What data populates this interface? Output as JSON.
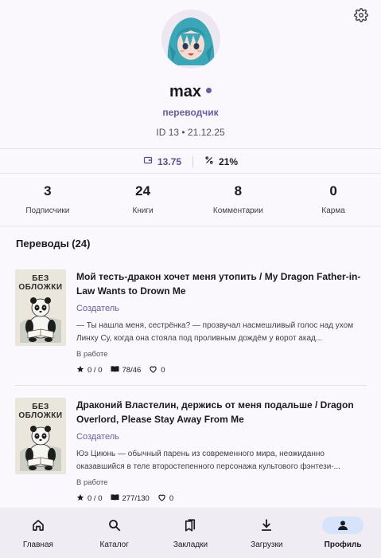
{
  "profile": {
    "name": "max",
    "role": "переводчик",
    "id_line": "ID 13 • 21.12.25",
    "balance": "13.75",
    "percent": "21%"
  },
  "counters": [
    {
      "value": "3",
      "label": "Подписчики"
    },
    {
      "value": "24",
      "label": "Книги"
    },
    {
      "value": "8",
      "label": "Комментарии"
    },
    {
      "value": "0",
      "label": "Карма"
    }
  ],
  "section": {
    "title": "Переводы (24)"
  },
  "books": [
    {
      "cover_text_1": "БЕЗ",
      "cover_text_2": "ОБЛОЖКИ",
      "title": "Мой тесть-дракон хочет меня утопить / My Dragon Father-in-Law Wants to Drown Me",
      "creator": "Создатель",
      "description": "— Ты нашла меня, сестрёнка? — прозвучал насмешливый голос над ухом Линху Су, когда она стояла под проливным дождём у ворот акад...",
      "status": "В работе",
      "rating": "0 / 0",
      "chapters": "78/46",
      "likes": "0"
    },
    {
      "cover_text_1": "БЕЗ",
      "cover_text_2": "ОБЛОЖКИ",
      "title": "Драконий Властелин, держись от меня подальше / Dragon Overlord, Please Stay Away From Me",
      "creator": "Создатель",
      "description": "Юэ Циюнь — обычный парень из современного мира, неожиданно оказавшийся в теле второстепенного персонажа культового фэнтези-...",
      "status": "В работе",
      "rating": "0 / 0",
      "chapters": "277/130",
      "likes": "0"
    }
  ],
  "nav": [
    {
      "label": "Главная",
      "icon": "home-icon"
    },
    {
      "label": "Каталог",
      "icon": "search-icon"
    },
    {
      "label": "Закладки",
      "icon": "bookmarks-icon"
    },
    {
      "label": "Загрузки",
      "icon": "download-icon"
    },
    {
      "label": "Профиль",
      "icon": "person-icon"
    }
  ],
  "colors": {
    "accent": "#6b5ba8",
    "nav_active_bg": "#d5e3fb",
    "background": "#fbf8fd"
  }
}
